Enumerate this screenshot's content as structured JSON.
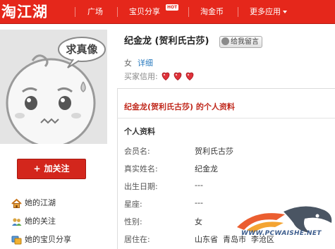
{
  "nav": {
    "logo": "淘江湖",
    "items": [
      {
        "label": "广场"
      },
      {
        "label": "宝贝分享"
      },
      {
        "label": "淘金币"
      },
      {
        "label": "更多应用"
      }
    ],
    "hot_badge": "HOT"
  },
  "avatar": {
    "bubble_text": "求真像"
  },
  "follow_button": {
    "plus": "+",
    "label": "加关注"
  },
  "side_links": [
    {
      "label": "她的江湖",
      "icon": "house-icon"
    },
    {
      "label": "她的关注",
      "icon": "people-icon"
    },
    {
      "label": "她的宝贝分享",
      "icon": "share-icon"
    }
  ],
  "profile": {
    "name": "纪金龙 (贺利氏古莎)",
    "message_button": "给我留言",
    "gender": "女",
    "detail_link": "详细",
    "credit_label": "买家信用:",
    "credit_hearts": 3
  },
  "panel": {
    "title": "纪金龙(贺利氏古莎) 的个人资料",
    "section": "个人资料",
    "fields": [
      {
        "label": "会员名:",
        "value": "贺利氏古莎"
      },
      {
        "label": "真实姓名:",
        "value": "纪金龙"
      },
      {
        "label": "出生日期:",
        "value": "---"
      },
      {
        "label": "星座:",
        "value": "---"
      },
      {
        "label": "性别:",
        "value": "女"
      },
      {
        "label": "居住在:",
        "value": "山东省  青岛市  李沧区"
      }
    ]
  },
  "watermark": {
    "text": "WWW.PCWAISHE.NET"
  },
  "colors": {
    "brand_red": "#e5271b",
    "link_blue": "#2a7bbf",
    "title_red": "#c0281c"
  }
}
